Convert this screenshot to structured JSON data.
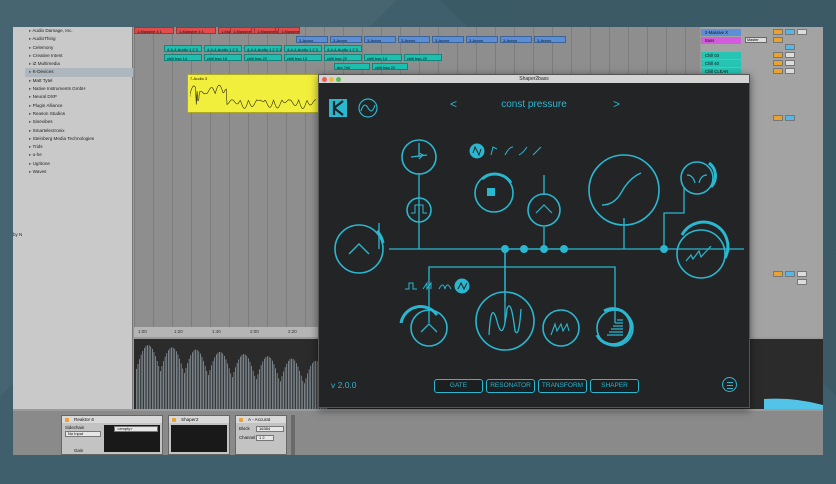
{
  "browser": {
    "items": [
      "Audio Damage, Inc.",
      "AudioThing",
      "Celemony",
      "Creative Intent",
      "iZ Multimedia",
      "K-Devices",
      "Matt Tytel",
      "Native Instruments GmbH",
      "Neural DSP",
      "Plugin Alliance",
      "Reason Studios",
      "Sinevibes",
      "Smartelectronix",
      "Steinberg Media Technologies",
      "Trids",
      "u-he",
      "Ugritone",
      "Waves"
    ],
    "selected_index": 5,
    "side_label": "by N"
  },
  "arrangement": {
    "clips_row1": [
      "1-Massive 4 1",
      "1-Massive 4 1",
      "1-Massive 4 1",
      "1-Massive 4 1",
      "1-Massive",
      "1-Massive 4",
      "1-Massive 4"
    ],
    "clips_row2": [
      "3-Appro",
      "3-Appro",
      "3-Appro",
      "3-Appro",
      "3-Appro",
      "3-Appro",
      "3-Appro",
      "3-Appro"
    ],
    "clips_row3": [
      "4-4-4-Audio 1 2 3",
      "4-4-4-Audio 1 2 3",
      "4-4-4-Audio 1 2 3 1",
      "4-4-4-Audio 1 2 3",
      "4-4-4-Audio 1 2 3"
    ],
    "clips_row4": [
      "chill bsg 14",
      "chill bsg 18",
      "chill bsg 22",
      "chill bsg 13",
      "chill bsg 22",
      "chill bsg 14",
      "chill bsg 22"
    ],
    "clips_row5": [
      "drp 7ell",
      "chill bsg 22"
    ],
    "audio_clip": "7-Audio 3",
    "ruler": [
      "1:00",
      "1:20",
      "1:40",
      "2:00",
      "2:20"
    ]
  },
  "mixer": {
    "tracks": [
      "2-Massive X",
      "Bass",
      "Chill 03",
      "Chill 40",
      "Chill CLEAN"
    ],
    "master_label": "Master"
  },
  "devices": [
    {
      "name": "Reaktor 6",
      "labels": [
        "Sidechain",
        "No Input",
        "Gain"
      ],
      "select": "<empty>"
    },
    {
      "name": "Shaper2"
    },
    {
      "name": "A - Accurat",
      "labels": [
        "Block",
        "Channel"
      ],
      "values": [
        "16384",
        "1 2"
      ]
    }
  ],
  "plugin": {
    "window_title": "Shaper2bass",
    "preset_name": "const pressure",
    "prev_symbol": "<",
    "next_symbol": ">",
    "version": "v 2.0.0",
    "tabs": [
      "GATE",
      "RESONATOR",
      "TRANSFORM",
      "SHAPER"
    ],
    "accent": "#2ab7d0",
    "icons": [
      "k-devices-logo-icon",
      "sine-wave-icon",
      "curve-shape-icons",
      "lfo-shape-icons",
      "gate-knob-icon",
      "resonator-knob-icon",
      "transform-knob-icon",
      "shaper-knob-icon",
      "menu-icon"
    ]
  }
}
